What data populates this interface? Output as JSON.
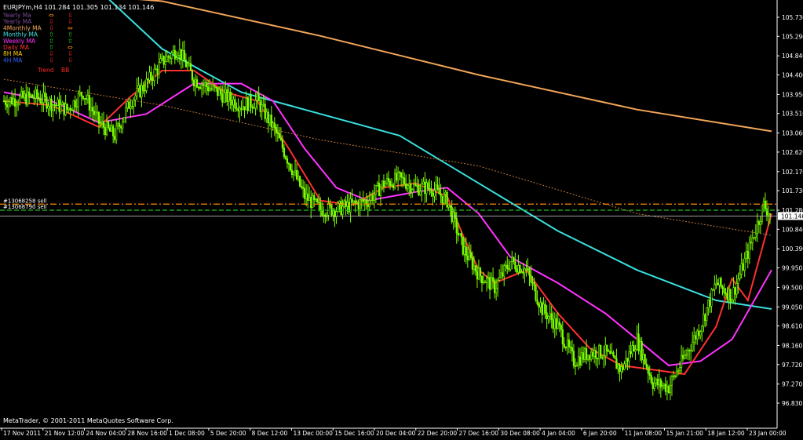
{
  "header": {
    "symbol_line": "EURJPYm,H4  101.284 101.305 101.134 101.146"
  },
  "legend": {
    "rows": [
      {
        "label": "Yearly Ma",
        "color": "#7a4a96",
        "arrow1": "⇔",
        "arrow2": "⇩",
        "c1": "#ff8c00",
        "c2": "#ff2a2a"
      },
      {
        "label": "Yearly MA",
        "color": "#7a4a96",
        "arrow1": "⇩",
        "arrow2": "⇩",
        "c1": "#ff2a2a",
        "c2": "#ff2a2a"
      },
      {
        "label": "4Monthly MA",
        "color": "#f2a65a",
        "arrow1": "⇩",
        "arrow2": "⇔",
        "c1": "#ff2a2a",
        "c2": "#ff8c00"
      },
      {
        "label": "Monthly MA",
        "color": "#39e0e0",
        "arrow1": "⇧",
        "arrow2": "⇧",
        "c1": "#22dd22",
        "c2": "#22dd22"
      },
      {
        "label": "Weekly MA",
        "color": "#ff33ff",
        "arrow1": "⇧",
        "arrow2": "⇧",
        "c1": "#22dd22",
        "c2": "#22dd22"
      },
      {
        "label": "Daily MA",
        "color": "#ff3030",
        "arrow1": "⇧",
        "arrow2": "⇔",
        "c1": "#22dd22",
        "c2": "#ff8c00"
      },
      {
        "label": "8H MA",
        "color": "#ffd000",
        "arrow1": "⇩",
        "arrow2": "⇩",
        "c1": "#ff2a2a",
        "c2": "#ff2a2a"
      },
      {
        "label": "4H MA",
        "color": "#3060ff",
        "arrow1": "⇩",
        "arrow2": "⇩",
        "c1": "#ff2a2a",
        "c2": "#ff2a2a"
      }
    ],
    "trend_label": "Trend",
    "bb_label": "BB"
  },
  "orders": [
    {
      "label": "#13068258 sell",
      "price": 101.42,
      "color": "#ff8c00"
    },
    {
      "label": "#13068790 sell",
      "price": 101.28,
      "color": "#20c020"
    }
  ],
  "footer": {
    "copyright": "MetaTrader, © 2001-2011 MetaQuotes Software Corp."
  },
  "chart_data": {
    "type": "candlestick",
    "symbol": "EURJPYm",
    "timeframe": "H4",
    "ohlc_last": {
      "open": 101.284,
      "high": 101.305,
      "low": 101.134,
      "close": 101.146
    },
    "current_price": 101.146,
    "y_ticks": [
      "105.730",
      "105.290",
      "104.840",
      "104.400",
      "103.950",
      "103.510",
      "103.060",
      "102.620",
      "102.170",
      "101.730",
      "101.280",
      "100.840",
      "100.390",
      "99.950",
      "99.500",
      "99.050",
      "98.610",
      "98.160",
      "97.720",
      "97.270",
      "96.830"
    ],
    "ylim": [
      96.83,
      105.73
    ],
    "x_ticks": [
      "17 Nov 2011",
      "21 Nov 12:00",
      "24 Nov 04:00",
      "28 Nov 16:00",
      "1 Dec 08:00",
      "5 Dec 20:00",
      "8 Dec 12:00",
      "13 Dec 00:00",
      "15 Dec 16:00",
      "20 Dec 04:00",
      "22 Dec 20:00",
      "27 Dec 16:00",
      "30 Dec 08:00",
      "4 Jan 04:00",
      "6 Jan 20:00",
      "11 Jan 08:00",
      "15 Jan 21:00",
      "18 Jan 12:00",
      "23 Jan 00:00"
    ],
    "price_path": [
      [
        0,
        103.8
      ],
      [
        4,
        103.9
      ],
      [
        8,
        103.6
      ],
      [
        10,
        104.0
      ],
      [
        12,
        103.3
      ],
      [
        14,
        103.0
      ],
      [
        16,
        103.8
      ],
      [
        18,
        104.2
      ],
      [
        20,
        104.7
      ],
      [
        22,
        105.0
      ],
      [
        24,
        104.3
      ],
      [
        26,
        104.1
      ],
      [
        28,
        103.9
      ],
      [
        30,
        103.7
      ],
      [
        32,
        103.8
      ],
      [
        34,
        103.2
      ],
      [
        36,
        102.4
      ],
      [
        38,
        101.6
      ],
      [
        40,
        101.3
      ],
      [
        42,
        101.3
      ],
      [
        44,
        101.4
      ],
      [
        46,
        101.5
      ],
      [
        48,
        101.9
      ],
      [
        50,
        102.0
      ],
      [
        52,
        101.8
      ],
      [
        54,
        101.8
      ],
      [
        56,
        101.5
      ],
      [
        58,
        100.4
      ],
      [
        60,
        99.8
      ],
      [
        62,
        99.5
      ],
      [
        64,
        100.1
      ],
      [
        66,
        99.9
      ],
      [
        68,
        99.0
      ],
      [
        70,
        98.6
      ],
      [
        72,
        97.8
      ],
      [
        74,
        98.0
      ],
      [
        76,
        98.0
      ],
      [
        78,
        97.6
      ],
      [
        80,
        98.3
      ],
      [
        82,
        97.3
      ],
      [
        84,
        97.2
      ],
      [
        86,
        97.9
      ],
      [
        88,
        98.6
      ],
      [
        90,
        99.6
      ],
      [
        92,
        99.3
      ],
      [
        94,
        100.3
      ],
      [
        96,
        101.4
      ],
      [
        97,
        101.15
      ]
    ],
    "series": [
      {
        "name": "Monthly MA",
        "color": "#39e0e0",
        "points": [
          [
            0,
            107.6
          ],
          [
            10,
            106.7
          ],
          [
            20,
            105.0
          ],
          [
            30,
            104.0
          ],
          [
            40,
            103.5
          ],
          [
            50,
            103.0
          ],
          [
            60,
            101.9
          ],
          [
            70,
            100.8
          ],
          [
            80,
            99.9
          ],
          [
            90,
            99.2
          ],
          [
            97,
            99.0
          ]
        ]
      },
      {
        "name": "Weekly MA",
        "color": "#ff33ff",
        "points": [
          [
            0,
            104.0
          ],
          [
            6,
            103.8
          ],
          [
            12,
            103.3
          ],
          [
            18,
            103.5
          ],
          [
            24,
            104.2
          ],
          [
            30,
            104.2
          ],
          [
            34,
            103.8
          ],
          [
            38,
            102.7
          ],
          [
            42,
            101.8
          ],
          [
            46,
            101.5
          ],
          [
            52,
            101.7
          ],
          [
            56,
            101.8
          ],
          [
            60,
            101.2
          ],
          [
            64,
            100.2
          ],
          [
            70,
            99.6
          ],
          [
            76,
            98.9
          ],
          [
            80,
            98.3
          ],
          [
            84,
            97.7
          ],
          [
            88,
            97.8
          ],
          [
            92,
            98.3
          ],
          [
            97,
            99.9
          ]
        ]
      },
      {
        "name": "Daily MA",
        "color": "#ff3030",
        "points": [
          [
            0,
            103.8
          ],
          [
            6,
            103.7
          ],
          [
            12,
            103.2
          ],
          [
            16,
            103.9
          ],
          [
            20,
            104.5
          ],
          [
            24,
            104.5
          ],
          [
            28,
            104.0
          ],
          [
            32,
            103.8
          ],
          [
            36,
            102.7
          ],
          [
            40,
            101.5
          ],
          [
            44,
            101.4
          ],
          [
            48,
            101.8
          ],
          [
            52,
            101.9
          ],
          [
            56,
            101.6
          ],
          [
            58,
            100.7
          ],
          [
            60,
            99.9
          ],
          [
            62,
            99.6
          ],
          [
            66,
            99.9
          ],
          [
            70,
            98.9
          ],
          [
            74,
            98.1
          ],
          [
            78,
            97.7
          ],
          [
            82,
            97.6
          ],
          [
            86,
            97.5
          ],
          [
            90,
            98.6
          ],
          [
            92,
            99.7
          ],
          [
            94,
            99.2
          ],
          [
            97,
            101.2
          ]
        ]
      },
      {
        "name": "4Monthly MA",
        "color": "#f2a65a",
        "points": [
          [
            0,
            106.4
          ],
          [
            20,
            106.1
          ],
          [
            40,
            105.3
          ],
          [
            60,
            104.4
          ],
          [
            80,
            103.6
          ],
          [
            97,
            103.1
          ]
        ]
      },
      {
        "name": "Yearly MA",
        "color": "#c07838",
        "dashed": true,
        "points": [
          [
            0,
            104.3
          ],
          [
            20,
            103.7
          ],
          [
            40,
            102.9
          ],
          [
            60,
            102.3
          ],
          [
            80,
            101.2
          ],
          [
            97,
            100.7
          ]
        ]
      }
    ],
    "grid": false,
    "legend_position": "top-left"
  }
}
